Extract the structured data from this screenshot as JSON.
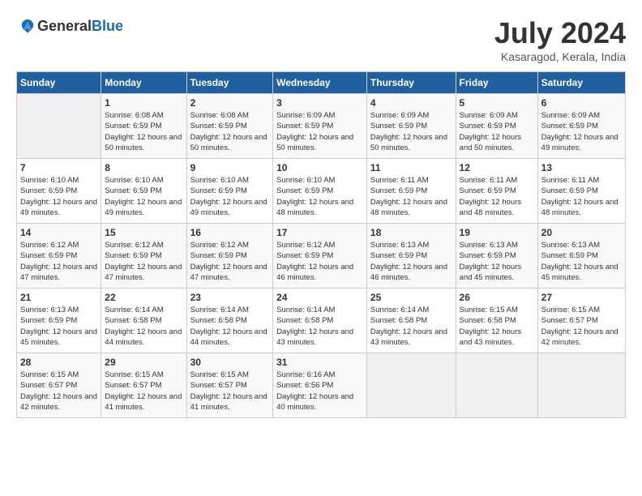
{
  "header": {
    "logo_general": "General",
    "logo_blue": "Blue",
    "title": "July 2024",
    "location": "Kasaragod, Kerala, India"
  },
  "weekdays": [
    "Sunday",
    "Monday",
    "Tuesday",
    "Wednesday",
    "Thursday",
    "Friday",
    "Saturday"
  ],
  "weeks": [
    [
      {
        "day": "",
        "sunrise": "",
        "sunset": "",
        "daylight": ""
      },
      {
        "day": "1",
        "sunrise": "6:08 AM",
        "sunset": "6:59 PM",
        "daylight": "12 hours and 50 minutes."
      },
      {
        "day": "2",
        "sunrise": "6:08 AM",
        "sunset": "6:59 PM",
        "daylight": "12 hours and 50 minutes."
      },
      {
        "day": "3",
        "sunrise": "6:09 AM",
        "sunset": "6:59 PM",
        "daylight": "12 hours and 50 minutes."
      },
      {
        "day": "4",
        "sunrise": "6:09 AM",
        "sunset": "6:59 PM",
        "daylight": "12 hours and 50 minutes."
      },
      {
        "day": "5",
        "sunrise": "6:09 AM",
        "sunset": "6:59 PM",
        "daylight": "12 hours and 50 minutes."
      },
      {
        "day": "6",
        "sunrise": "6:09 AM",
        "sunset": "6:59 PM",
        "daylight": "12 hours and 49 minutes."
      }
    ],
    [
      {
        "day": "7",
        "sunrise": "6:10 AM",
        "sunset": "6:59 PM",
        "daylight": "12 hours and 49 minutes."
      },
      {
        "day": "8",
        "sunrise": "6:10 AM",
        "sunset": "6:59 PM",
        "daylight": "12 hours and 49 minutes."
      },
      {
        "day": "9",
        "sunrise": "6:10 AM",
        "sunset": "6:59 PM",
        "daylight": "12 hours and 49 minutes."
      },
      {
        "day": "10",
        "sunrise": "6:10 AM",
        "sunset": "6:59 PM",
        "daylight": "12 hours and 48 minutes."
      },
      {
        "day": "11",
        "sunrise": "6:11 AM",
        "sunset": "6:59 PM",
        "daylight": "12 hours and 48 minutes."
      },
      {
        "day": "12",
        "sunrise": "6:11 AM",
        "sunset": "6:59 PM",
        "daylight": "12 hours and 48 minutes."
      },
      {
        "day": "13",
        "sunrise": "6:11 AM",
        "sunset": "6:59 PM",
        "daylight": "12 hours and 48 minutes."
      }
    ],
    [
      {
        "day": "14",
        "sunrise": "6:12 AM",
        "sunset": "6:59 PM",
        "daylight": "12 hours and 47 minutes."
      },
      {
        "day": "15",
        "sunrise": "6:12 AM",
        "sunset": "6:59 PM",
        "daylight": "12 hours and 47 minutes."
      },
      {
        "day": "16",
        "sunrise": "6:12 AM",
        "sunset": "6:59 PM",
        "daylight": "12 hours and 47 minutes."
      },
      {
        "day": "17",
        "sunrise": "6:12 AM",
        "sunset": "6:59 PM",
        "daylight": "12 hours and 46 minutes."
      },
      {
        "day": "18",
        "sunrise": "6:13 AM",
        "sunset": "6:59 PM",
        "daylight": "12 hours and 46 minutes."
      },
      {
        "day": "19",
        "sunrise": "6:13 AM",
        "sunset": "6:59 PM",
        "daylight": "12 hours and 45 minutes."
      },
      {
        "day": "20",
        "sunrise": "6:13 AM",
        "sunset": "6:59 PM",
        "daylight": "12 hours and 45 minutes."
      }
    ],
    [
      {
        "day": "21",
        "sunrise": "6:13 AM",
        "sunset": "6:59 PM",
        "daylight": "12 hours and 45 minutes."
      },
      {
        "day": "22",
        "sunrise": "6:14 AM",
        "sunset": "6:58 PM",
        "daylight": "12 hours and 44 minutes."
      },
      {
        "day": "23",
        "sunrise": "6:14 AM",
        "sunset": "6:58 PM",
        "daylight": "12 hours and 44 minutes."
      },
      {
        "day": "24",
        "sunrise": "6:14 AM",
        "sunset": "6:58 PM",
        "daylight": "12 hours and 43 minutes."
      },
      {
        "day": "25",
        "sunrise": "6:14 AM",
        "sunset": "6:58 PM",
        "daylight": "12 hours and 43 minutes."
      },
      {
        "day": "26",
        "sunrise": "6:15 AM",
        "sunset": "6:58 PM",
        "daylight": "12 hours and 43 minutes."
      },
      {
        "day": "27",
        "sunrise": "6:15 AM",
        "sunset": "6:57 PM",
        "daylight": "12 hours and 42 minutes."
      }
    ],
    [
      {
        "day": "28",
        "sunrise": "6:15 AM",
        "sunset": "6:57 PM",
        "daylight": "12 hours and 42 minutes."
      },
      {
        "day": "29",
        "sunrise": "6:15 AM",
        "sunset": "6:57 PM",
        "daylight": "12 hours and 41 minutes."
      },
      {
        "day": "30",
        "sunrise": "6:15 AM",
        "sunset": "6:57 PM",
        "daylight": "12 hours and 41 minutes."
      },
      {
        "day": "31",
        "sunrise": "6:16 AM",
        "sunset": "6:56 PM",
        "daylight": "12 hours and 40 minutes."
      },
      {
        "day": "",
        "sunrise": "",
        "sunset": "",
        "daylight": ""
      },
      {
        "day": "",
        "sunrise": "",
        "sunset": "",
        "daylight": ""
      },
      {
        "day": "",
        "sunrise": "",
        "sunset": "",
        "daylight": ""
      }
    ]
  ]
}
